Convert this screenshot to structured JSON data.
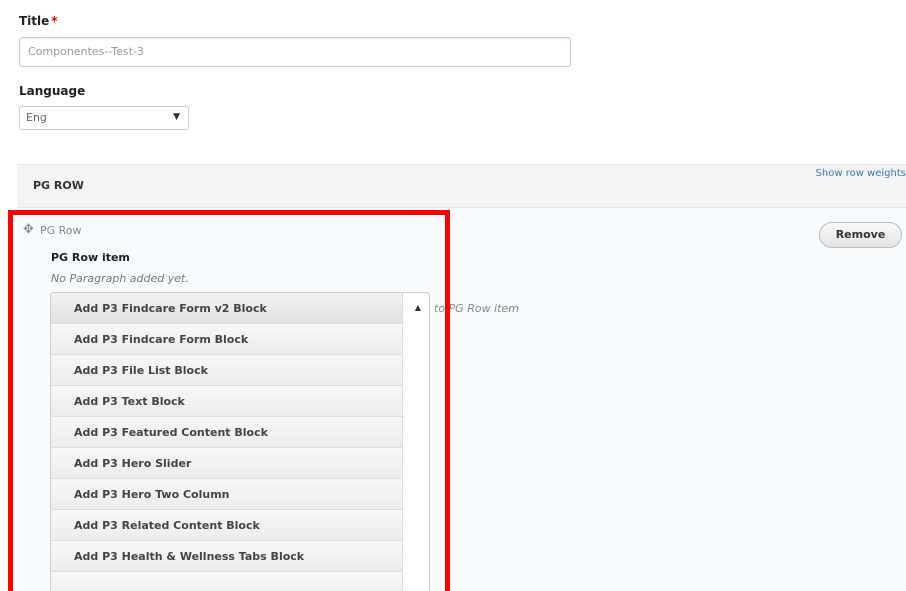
{
  "form": {
    "title_label": "Title",
    "required_mark": "*",
    "title_value": "Componentes--Test-3",
    "language_label": "Language",
    "language_value": "Eng",
    "show_row_weights": "Show row weights"
  },
  "pg_section": {
    "header": "PG ROW",
    "row_label": "PG Row",
    "remove_label": "Remove",
    "row_item_label": "PG Row item",
    "no_paragraph": "No Paragraph added yet.",
    "to_label": "to PG Row item"
  },
  "add_menu": {
    "items": [
      "Add P3 Findcare Form v2 Block",
      "Add P3 Findcare Form Block",
      "Add P3 File List Block",
      "Add P3 Text Block",
      "Add P3 Featured Content Block",
      "Add P3 Hero Slider",
      "Add P3 Hero Two Column",
      "Add P3 Related Content Block",
      "Add P3 Health & Wellness Tabs Block"
    ]
  },
  "colors": {
    "link": "#3a7bbf",
    "required": "#e00000",
    "highlight": "#ff0000"
  },
  "icons": {
    "drag": "move-handle-icon",
    "dropdown": "caret-down-icon"
  }
}
